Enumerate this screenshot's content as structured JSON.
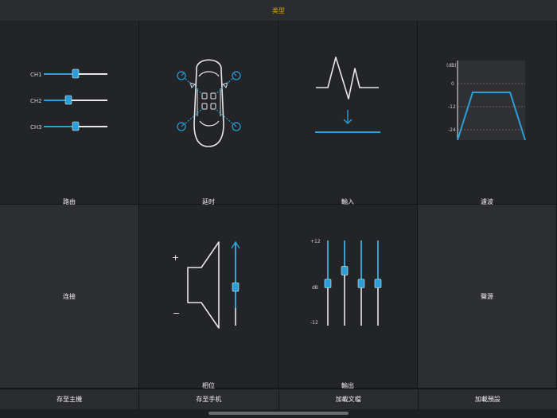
{
  "title": "类型",
  "cells": {
    "routing": {
      "label": "路由",
      "channels": [
        {
          "name": "CH1",
          "level": 0.5
        },
        {
          "name": "CH2",
          "level": 0.4
        },
        {
          "name": "CH3",
          "level": 0.5
        }
      ]
    },
    "delay": {
      "label": "延时"
    },
    "input": {
      "label": "輸入"
    },
    "filter": {
      "label": "濾波",
      "unit": "(dB)",
      "ticks": [
        "0",
        "-12",
        "-24"
      ]
    },
    "connect": {
      "label": "连接"
    },
    "phase": {
      "label": "相位",
      "plus": "+",
      "minus": "−"
    },
    "output": {
      "label": "輸出",
      "top_tick": "+12",
      "mid_tick": "dB",
      "bottom_tick": "-12",
      "levels": [
        0.5,
        0.35,
        0.5,
        0.5
      ]
    },
    "source": {
      "label": "聲源"
    }
  },
  "bottom": {
    "save_host": "存至主機",
    "save_phone": "存至手机",
    "load_file": "加載文檔",
    "load_preset": "加載預設"
  },
  "colors": {
    "accent": "#2a9fd8",
    "title": "#e0a800"
  }
}
